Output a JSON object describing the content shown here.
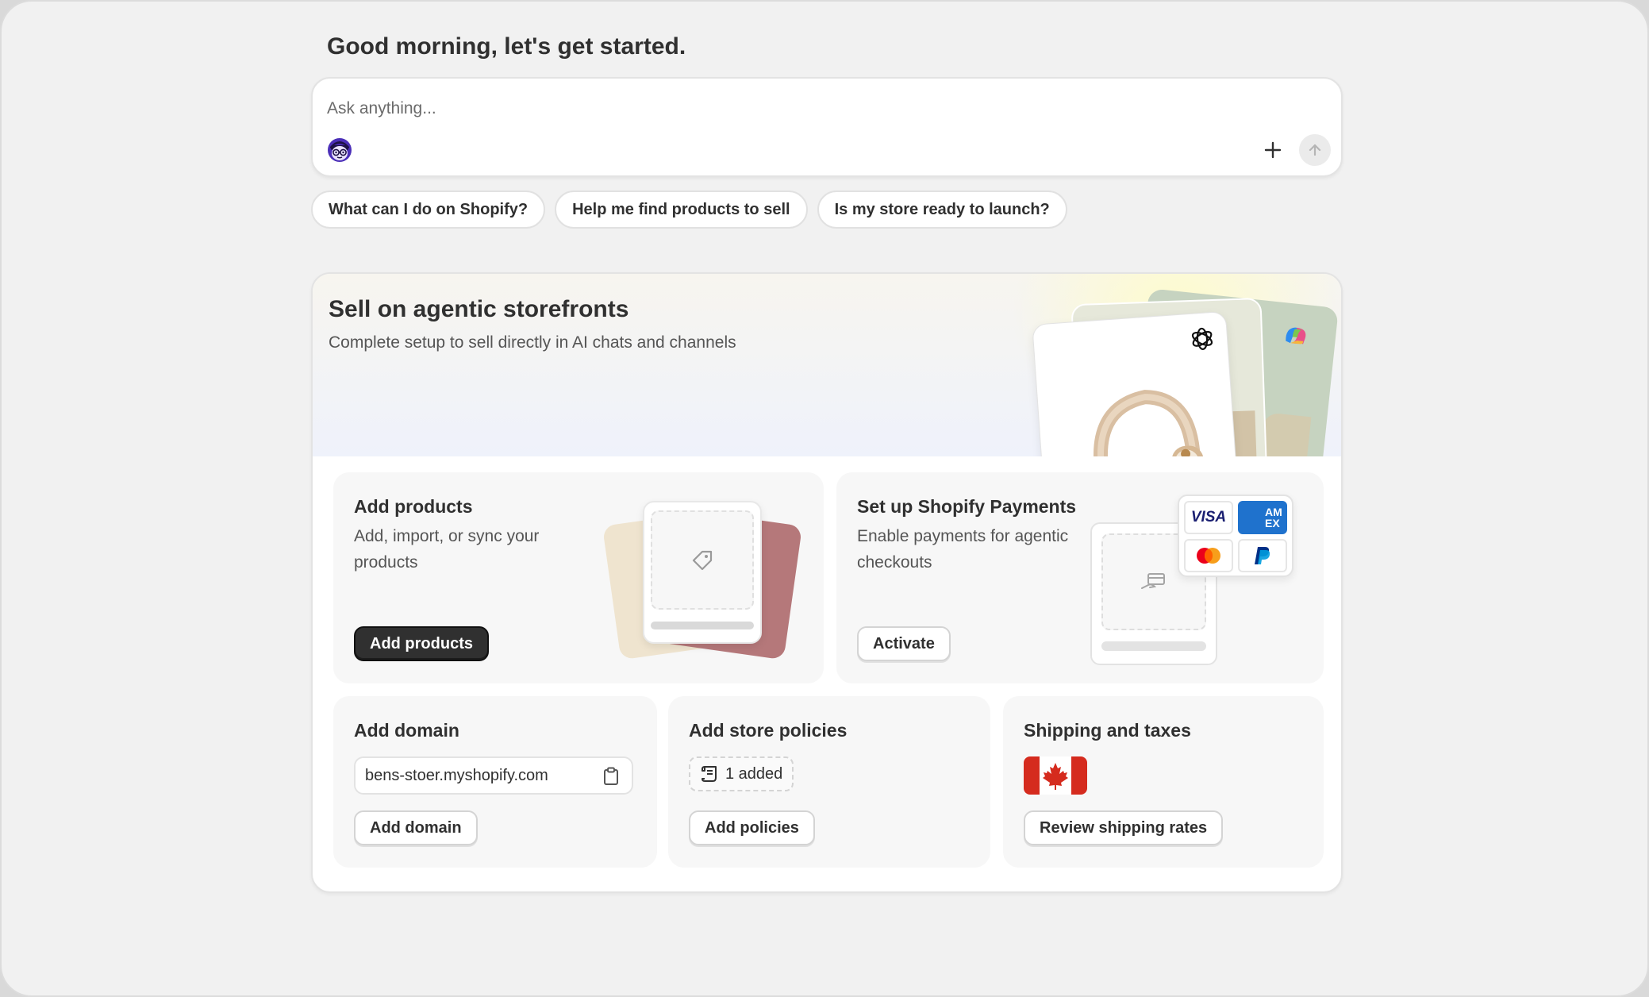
{
  "greeting": "Good morning, let's get started.",
  "ask": {
    "placeholder": "Ask anything..."
  },
  "chips": [
    "What can I do on Shopify?",
    "Help me find products to sell",
    "Is my store ready to launch?"
  ],
  "hero": {
    "title": "Sell on agentic storefronts",
    "subtitle": "Complete setup to sell directly in AI chats and channels"
  },
  "tasks": {
    "products": {
      "title": "Add products",
      "desc": "Add, import, or sync your products",
      "button": "Add products"
    },
    "payments": {
      "title": "Set up Shopify Payments",
      "desc": "Enable payments for agentic checkouts",
      "button": "Activate",
      "visa": "VISA",
      "amex": "AM EX"
    },
    "domain": {
      "title": "Add domain",
      "value": "bens-stoer.myshopify.com",
      "button": "Add domain"
    },
    "policies": {
      "title": "Add store policies",
      "badge": "1 added",
      "button": "Add policies"
    },
    "shipping": {
      "title": "Shipping and taxes",
      "button": "Review shipping rates"
    }
  },
  "colors": {
    "primary_button": "#303030",
    "background": "#f1f1f1",
    "flag_red": "#d52b1e"
  }
}
